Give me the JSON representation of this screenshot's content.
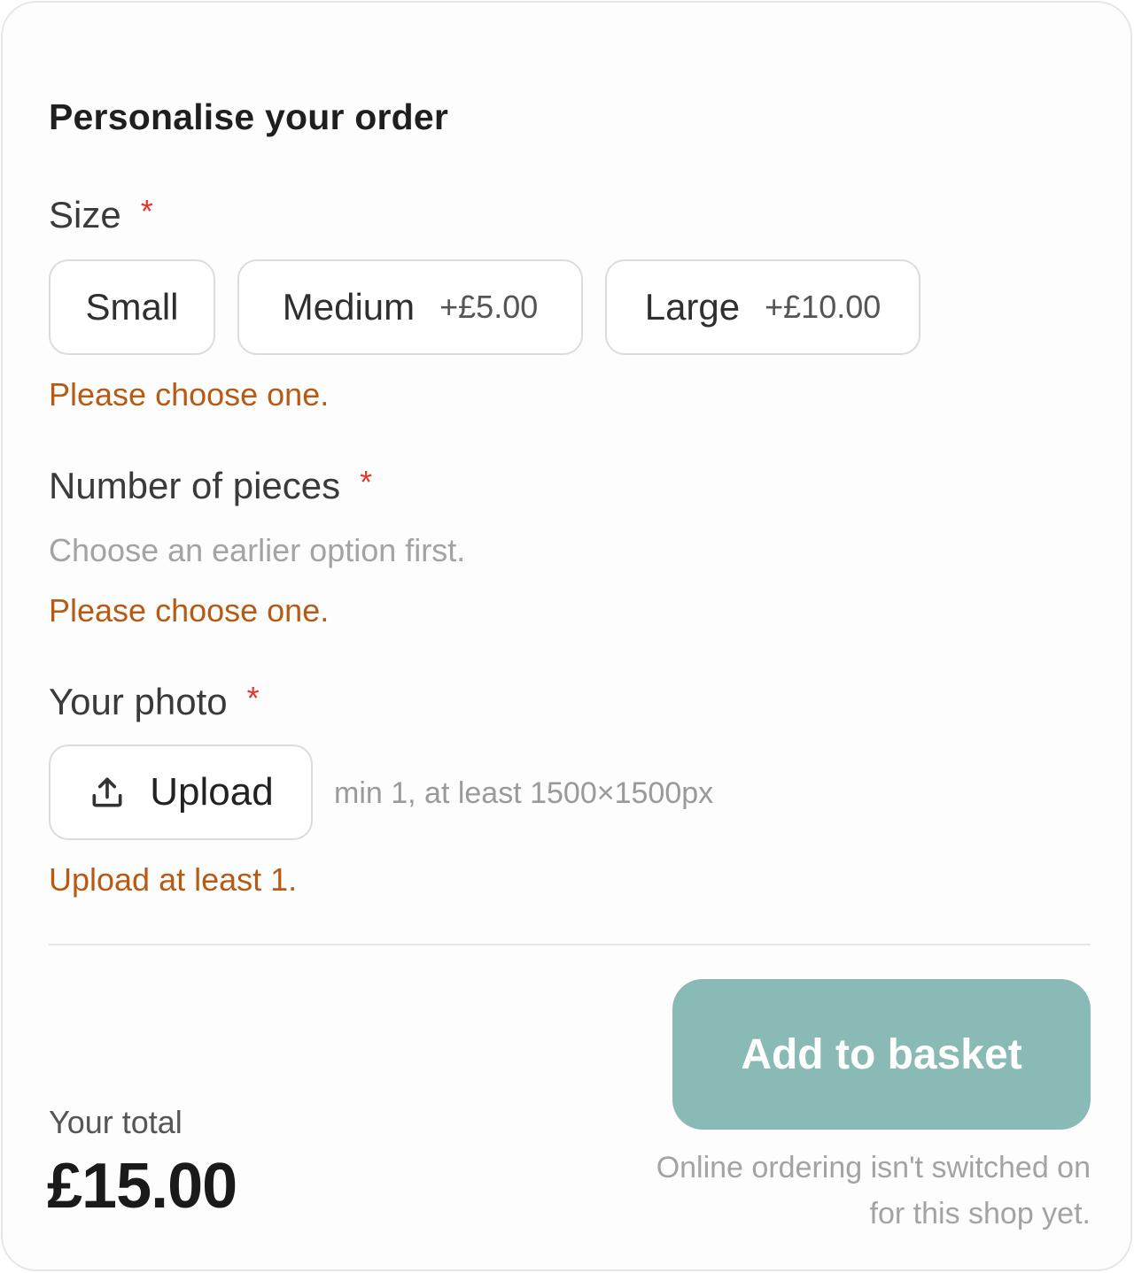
{
  "form": {
    "title": "Personalise your order",
    "required_marker": "*",
    "size": {
      "label": "Size",
      "options": [
        {
          "name": "Small",
          "price": ""
        },
        {
          "name": "Medium",
          "price": "+£5.00"
        },
        {
          "name": "Large",
          "price": "+£10.00"
        }
      ],
      "error": "Please choose one."
    },
    "pieces": {
      "label": "Number of pieces",
      "hint": "Choose an earlier option first.",
      "error": "Please choose one."
    },
    "photo": {
      "label": "Your photo",
      "upload_label": "Upload",
      "upload_icon": "upload-icon",
      "requirements": "min 1, at least 1500×1500px",
      "error": "Upload at least 1."
    }
  },
  "footer": {
    "total_label": "Your total",
    "total_value": "£15.00",
    "add_button": "Add to basket",
    "notice": "Online ordering isn't switched on for this shop yet."
  },
  "colors": {
    "accent": "#89bab5",
    "error": "#b85a13",
    "required": "#e0362c"
  }
}
